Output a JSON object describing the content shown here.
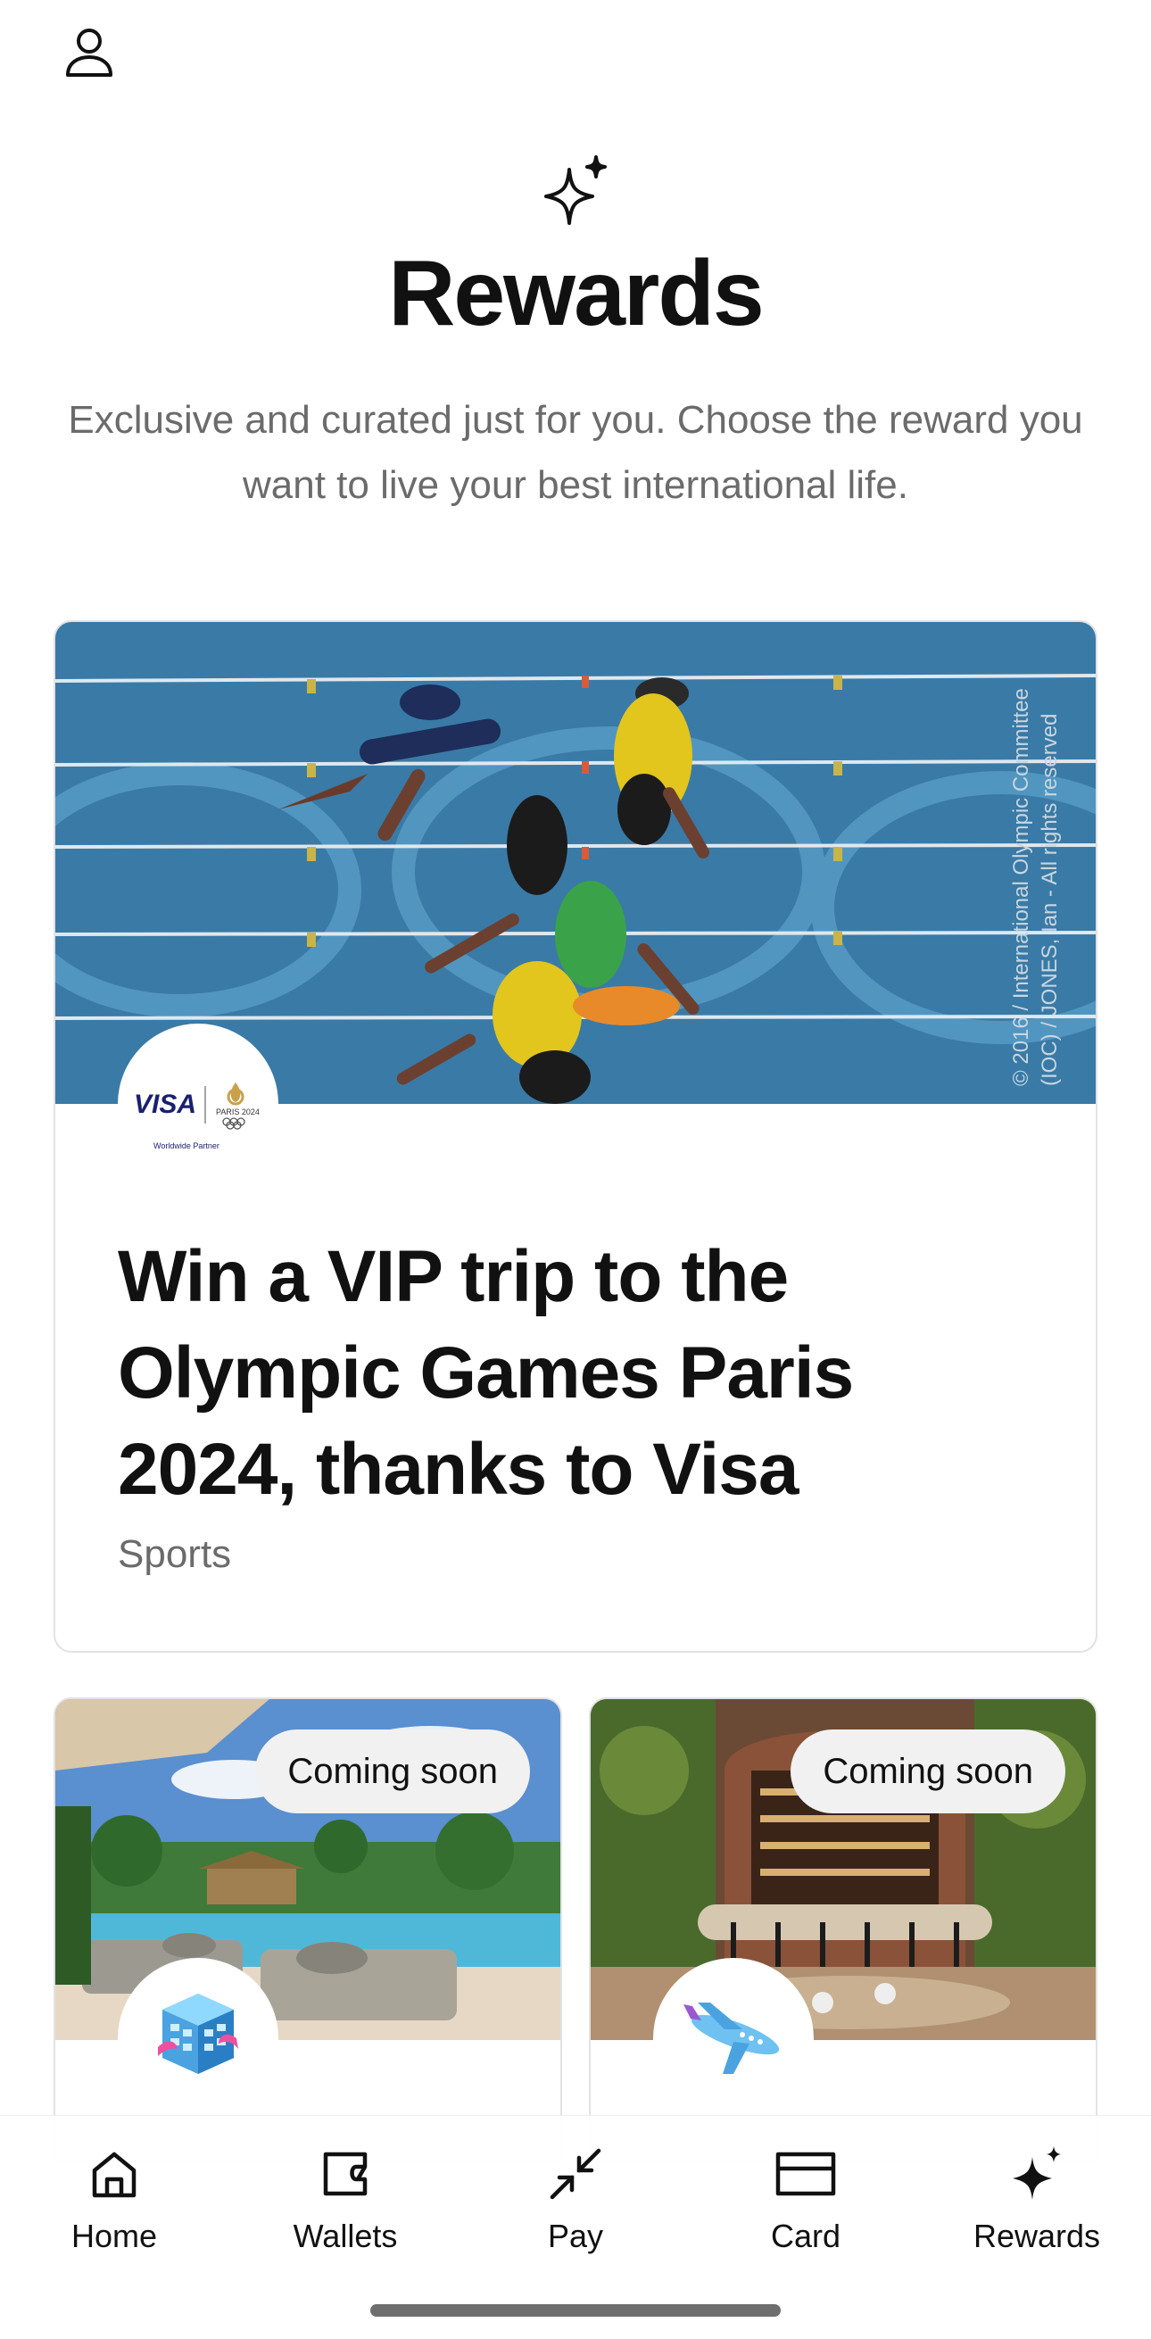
{
  "header": {
    "profile_icon": "person-outline-icon",
    "hero_icon": "sparkle-icon",
    "title": "Rewards",
    "subtitle": "Exclusive and curated just for you. Choose the reward you want to live your best international life."
  },
  "featured": {
    "title": "Win a VIP trip to the Olympic Games Paris 2024, thanks to Visa",
    "category": "Sports",
    "image_caption": "© 2016 / International Olympic Committee (IOC) / JONES, Ian - All rights reserved",
    "brand_logo": {
      "visa": "VISA",
      "paris": "PARIS 2024",
      "partner": "Worldwide Partner"
    }
  },
  "rewards": [
    {
      "badge": "Coming soon",
      "icon": "hotel-building-icon",
      "image": "resort-pool-photo"
    },
    {
      "badge": "Coming soon",
      "icon": "airplane-icon",
      "image": "restaurant-interior-photo"
    }
  ],
  "tabbar": {
    "items": [
      {
        "label": "Home",
        "icon": "home-icon"
      },
      {
        "label": "Wallets",
        "icon": "wallet-icon"
      },
      {
        "label": "Pay",
        "icon": "pay-arrows-icon"
      },
      {
        "label": "Card",
        "icon": "card-icon"
      },
      {
        "label": "Rewards",
        "icon": "sparkle-icon"
      }
    ]
  },
  "colors": {
    "text": "#111111",
    "muted": "#6b6b6b",
    "border": "#e2e2e2",
    "pill": "#f1f1f1",
    "visa_blue": "#1a1f71",
    "track_blue": "#3a7aa6"
  }
}
